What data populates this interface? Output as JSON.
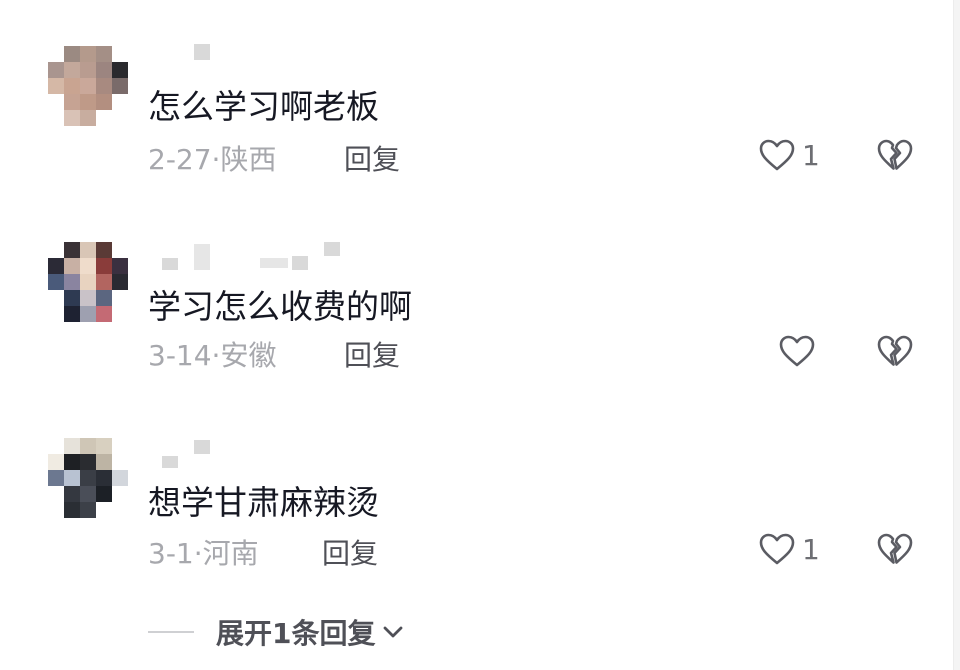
{
  "comments": [
    {
      "text": "怎么学习啊老板",
      "date": "2-27",
      "location": "陕西",
      "reply_label": "回复",
      "likes": "1"
    },
    {
      "text": "学习怎么收费的啊",
      "date": "3-14",
      "location": "安徽",
      "reply_label": "回复",
      "likes": ""
    },
    {
      "text": "想学甘肃麻辣烫",
      "date": "3-1",
      "location": "河南",
      "reply_label": "回复",
      "likes": "1"
    }
  ],
  "meta_separator": "·",
  "expand_replies_label": "展开1条回复",
  "icons": {
    "like": "heart-outline-icon",
    "dislike": "broken-heart-icon",
    "expand": "chevron-down-icon"
  },
  "colors": {
    "primary_text": "#161823",
    "secondary_text": "#a7a8ad",
    "action_text": "#4f5057",
    "icon": "#5b5c63"
  }
}
